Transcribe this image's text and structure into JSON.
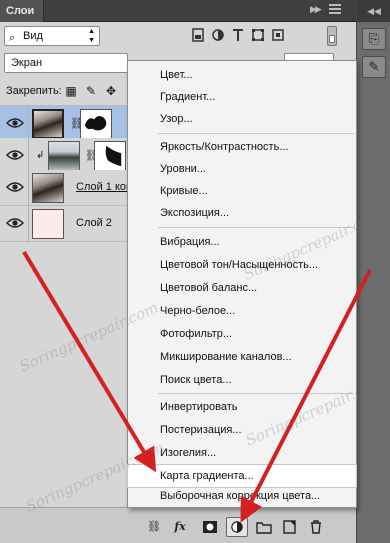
{
  "panel": {
    "tab_title": "Слои"
  },
  "filter": {
    "kind_label": "Вид"
  },
  "blend": {
    "mode": "Экран"
  },
  "lock": {
    "label": "Закрепить:"
  },
  "layers": [
    {
      "name": "",
      "selected": true
    },
    {
      "name": "",
      "selected": false
    },
    {
      "name": "Слой 1 копия",
      "selected": false
    },
    {
      "name": "Слой 2",
      "selected": false
    }
  ],
  "menu": {
    "items": [
      "Цвет...",
      "Градиент...",
      "Узор...",
      "Яркость/Контрастность...",
      "Уровни...",
      "Кривые...",
      "Экспозиция...",
      "Вибрация...",
      "Цветовой тон/Насыщенность...",
      "Цветовой баланс...",
      "Черно-белое...",
      "Фотофильтр...",
      "Микширование каналов...",
      "Поиск цвета...",
      "Инвертировать",
      "Постеризация...",
      "Изогелия...",
      "Карта градиента...",
      "Выборочная коррекция цвета..."
    ],
    "highlighted": "Карта градиента..."
  },
  "bottom_bar": {
    "fx_label": "fx"
  },
  "watermark": "Soringpcrepair.com",
  "colors": {
    "selected_layer": "#a7c0e6",
    "arrow": "#d42020",
    "panel_bg": "#d6d6d6",
    "header_bg": "#3f3f3f"
  },
  "icons": [
    "eye-icon",
    "chain-link-icon",
    "link-icon",
    "fx-icon",
    "mask-icon",
    "adjustment-layer-icon",
    "folder-icon",
    "new-layer-icon",
    "trash-icon",
    "panel-menu-icon"
  ]
}
